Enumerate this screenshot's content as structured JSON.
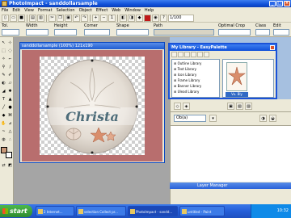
{
  "app": {
    "title": "PhotoImpact - sanddollarsample"
  },
  "menu": [
    "File",
    "Edit",
    "View",
    "Format",
    "Selection",
    "Object",
    "Effect",
    "Web",
    "Window",
    "Help"
  ],
  "options": {
    "labels": [
      "Tol.",
      "Width",
      "Height",
      "Corner",
      "Shape",
      "Path",
      "Optimal Crop",
      "Class",
      "Edit"
    ],
    "combo_value": "1/100"
  },
  "image_window": {
    "title": "sanddollarsample (100%) 121x190",
    "overlay_text": "Christa"
  },
  "library": {
    "title": "My Library - EasyPalette",
    "items": [
      "Outline Library",
      "Text Library",
      "Icon Library",
      "Frame Library",
      "Banner Library",
      "Ulead Library"
    ],
    "thumbnail_label": "Vu. Bly"
  },
  "right_panel": {
    "dropdown": "Ob(a)",
    "layers_title": "Layer Manager"
  },
  "taskbar": {
    "start_label": "start",
    "tasks": [
      "2 Internet...",
      "selection Collect pr...",
      "PhotoImpact - sandd...",
      "untitled - Paint"
    ],
    "clock": "10:32"
  }
}
